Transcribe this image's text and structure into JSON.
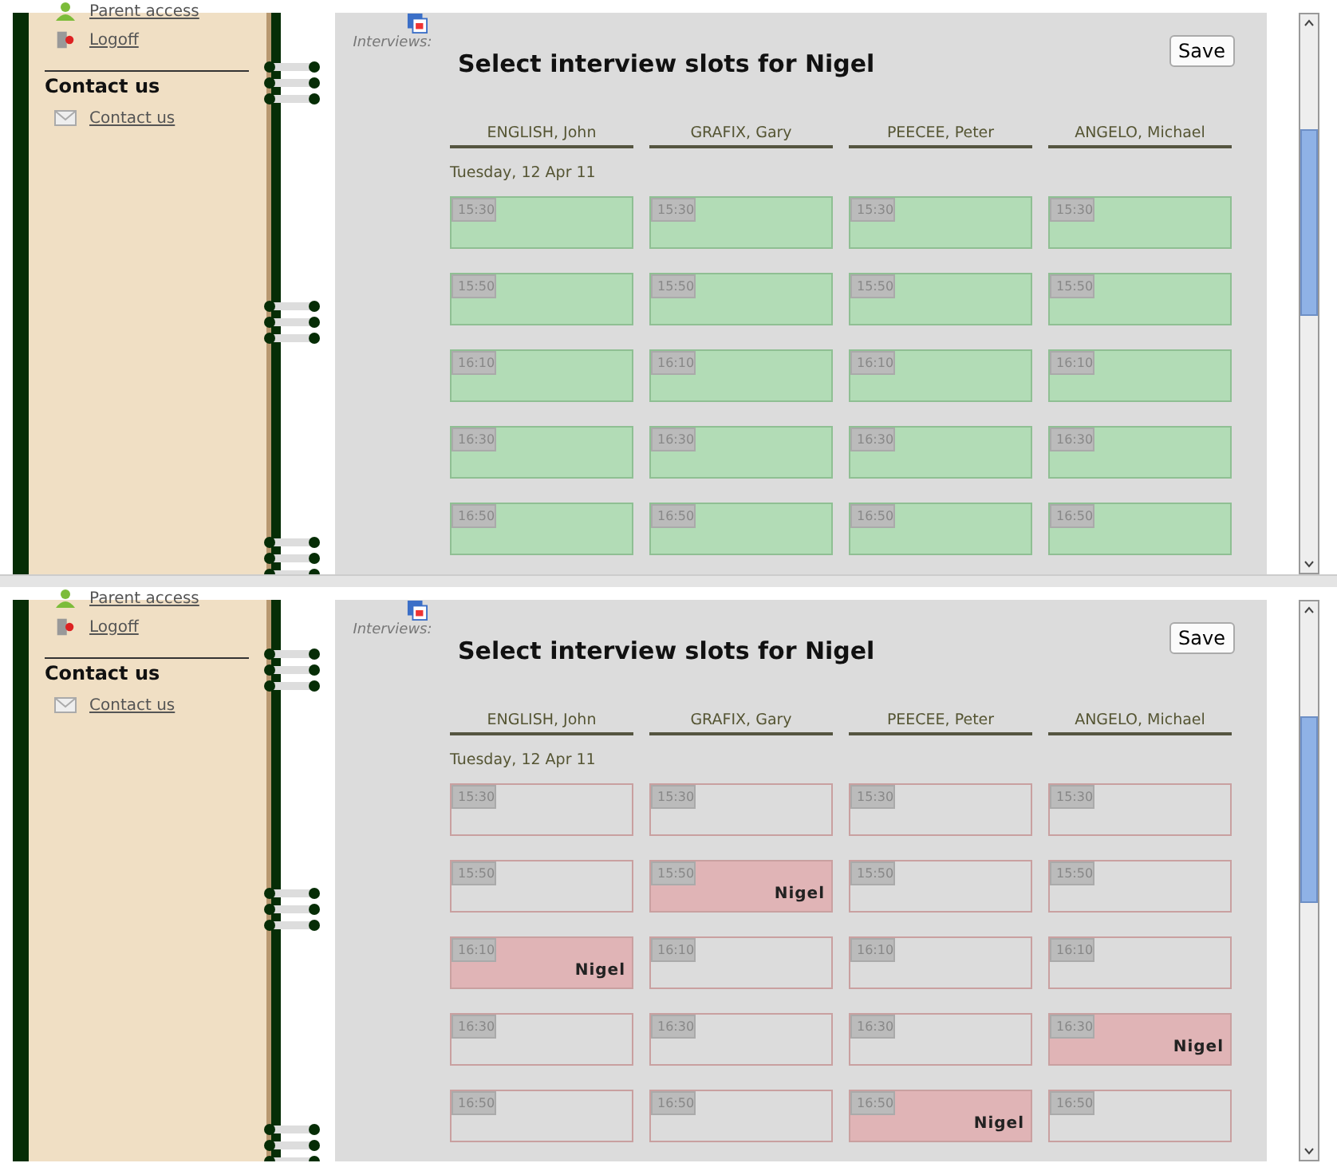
{
  "panels": [
    {
      "sidebar": {
        "links": [
          {
            "kind": "parent",
            "label": "Parent access"
          },
          {
            "kind": "logoff",
            "label": "Logoff"
          }
        ],
        "section_title": "Contact us",
        "section_links": [
          {
            "kind": "mail",
            "label": "Contact us"
          }
        ]
      },
      "module_label": "Interviews:",
      "title": "Select interview slots for Nigel",
      "save_button": "Save",
      "columns": [
        "ENGLISH, John",
        "GRAFIX, Gary",
        "PEECEE, Peter",
        "ANGELO, Michael"
      ],
      "date": "Tuesday, 12 Apr 11",
      "rows": [
        {
          "slots": [
            {
              "time": "15:30",
              "kind": "open"
            },
            {
              "time": "15:30",
              "kind": "open"
            },
            {
              "time": "15:30",
              "kind": "open"
            },
            {
              "time": "15:30",
              "kind": "open"
            }
          ]
        },
        {
          "slots": [
            {
              "time": "15:50",
              "kind": "open"
            },
            {
              "time": "15:50",
              "kind": "open"
            },
            {
              "time": "15:50",
              "kind": "open"
            },
            {
              "time": "15:50",
              "kind": "open"
            }
          ]
        },
        {
          "slots": [
            {
              "time": "16:10",
              "kind": "open"
            },
            {
              "time": "16:10",
              "kind": "open"
            },
            {
              "time": "16:10",
              "kind": "open"
            },
            {
              "time": "16:10",
              "kind": "open"
            }
          ]
        },
        {
          "slots": [
            {
              "time": "16:30",
              "kind": "open"
            },
            {
              "time": "16:30",
              "kind": "open"
            },
            {
              "time": "16:30",
              "kind": "open"
            },
            {
              "time": "16:30",
              "kind": "open"
            }
          ]
        },
        {
          "slots": [
            {
              "time": "16:50",
              "kind": "open"
            },
            {
              "time": "16:50",
              "kind": "open"
            },
            {
              "time": "16:50",
              "kind": "open"
            },
            {
              "time": "16:50",
              "kind": "open"
            }
          ]
        }
      ]
    },
    {
      "sidebar": {
        "links": [
          {
            "kind": "parent",
            "label": "Parent access"
          },
          {
            "kind": "logoff",
            "label": "Logoff"
          }
        ],
        "section_title": "Contact us",
        "section_links": [
          {
            "kind": "mail",
            "label": "Contact us"
          }
        ]
      },
      "module_label": "Interviews:",
      "title": "Select interview slots for Nigel",
      "save_button": "Save",
      "columns": [
        "ENGLISH, John",
        "GRAFIX, Gary",
        "PEECEE, Peter",
        "ANGELO, Michael"
      ],
      "date": "Tuesday, 12 Apr 11",
      "rows": [
        {
          "slots": [
            {
              "time": "15:30",
              "kind": "empty"
            },
            {
              "time": "15:30",
              "kind": "empty"
            },
            {
              "time": "15:30",
              "kind": "empty"
            },
            {
              "time": "15:30",
              "kind": "empty"
            }
          ]
        },
        {
          "slots": [
            {
              "time": "15:50",
              "kind": "empty"
            },
            {
              "time": "15:50",
              "kind": "booked",
              "name": "Nigel"
            },
            {
              "time": "15:50",
              "kind": "empty"
            },
            {
              "time": "15:50",
              "kind": "empty"
            }
          ]
        },
        {
          "slots": [
            {
              "time": "16:10",
              "kind": "booked",
              "name": "Nigel"
            },
            {
              "time": "16:10",
              "kind": "empty"
            },
            {
              "time": "16:10",
              "kind": "empty"
            },
            {
              "time": "16:10",
              "kind": "empty"
            }
          ]
        },
        {
          "slots": [
            {
              "time": "16:30",
              "kind": "empty"
            },
            {
              "time": "16:30",
              "kind": "empty"
            },
            {
              "time": "16:30",
              "kind": "empty"
            },
            {
              "time": "16:30",
              "kind": "booked",
              "name": "Nigel"
            }
          ]
        },
        {
          "slots": [
            {
              "time": "16:50",
              "kind": "empty"
            },
            {
              "time": "16:50",
              "kind": "empty"
            },
            {
              "time": "16:50",
              "kind": "booked",
              "name": "Nigel"
            },
            {
              "time": "16:50",
              "kind": "empty"
            }
          ]
        }
      ]
    }
  ]
}
